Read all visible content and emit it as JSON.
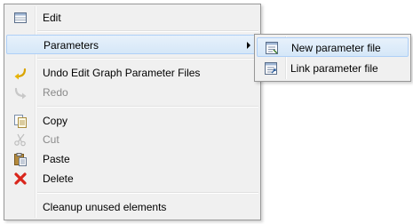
{
  "context_menu": {
    "items": [
      {
        "label": "Edit",
        "icon": "table-icon",
        "enabled": true
      },
      {
        "label": "Parameters",
        "icon": "",
        "enabled": true,
        "has_submenu": true,
        "highlighted": true
      },
      {
        "label": "Undo Edit Graph Parameter Files",
        "icon": "undo-icon",
        "enabled": true
      },
      {
        "label": "Redo",
        "icon": "redo-icon",
        "enabled": false
      },
      {
        "label": "Copy",
        "icon": "copy-icon",
        "enabled": true
      },
      {
        "label": "Cut",
        "icon": "cut-icon",
        "enabled": false
      },
      {
        "label": "Paste",
        "icon": "paste-icon",
        "enabled": true
      },
      {
        "label": "Delete",
        "icon": "delete-icon",
        "enabled": true
      },
      {
        "label": "Cleanup unused elements",
        "icon": "",
        "enabled": true
      }
    ]
  },
  "submenu": {
    "items": [
      {
        "label": "New parameter file",
        "icon": "parameter-file-new-icon",
        "highlighted": true
      },
      {
        "label": "Link parameter file",
        "icon": "parameter-file-link-icon"
      }
    ]
  },
  "colors": {
    "menu_bg": "#f0f0f0",
    "highlight": "#d5e7f8",
    "delete_red": "#d9261c",
    "undo_yellow": "#e0b000"
  }
}
